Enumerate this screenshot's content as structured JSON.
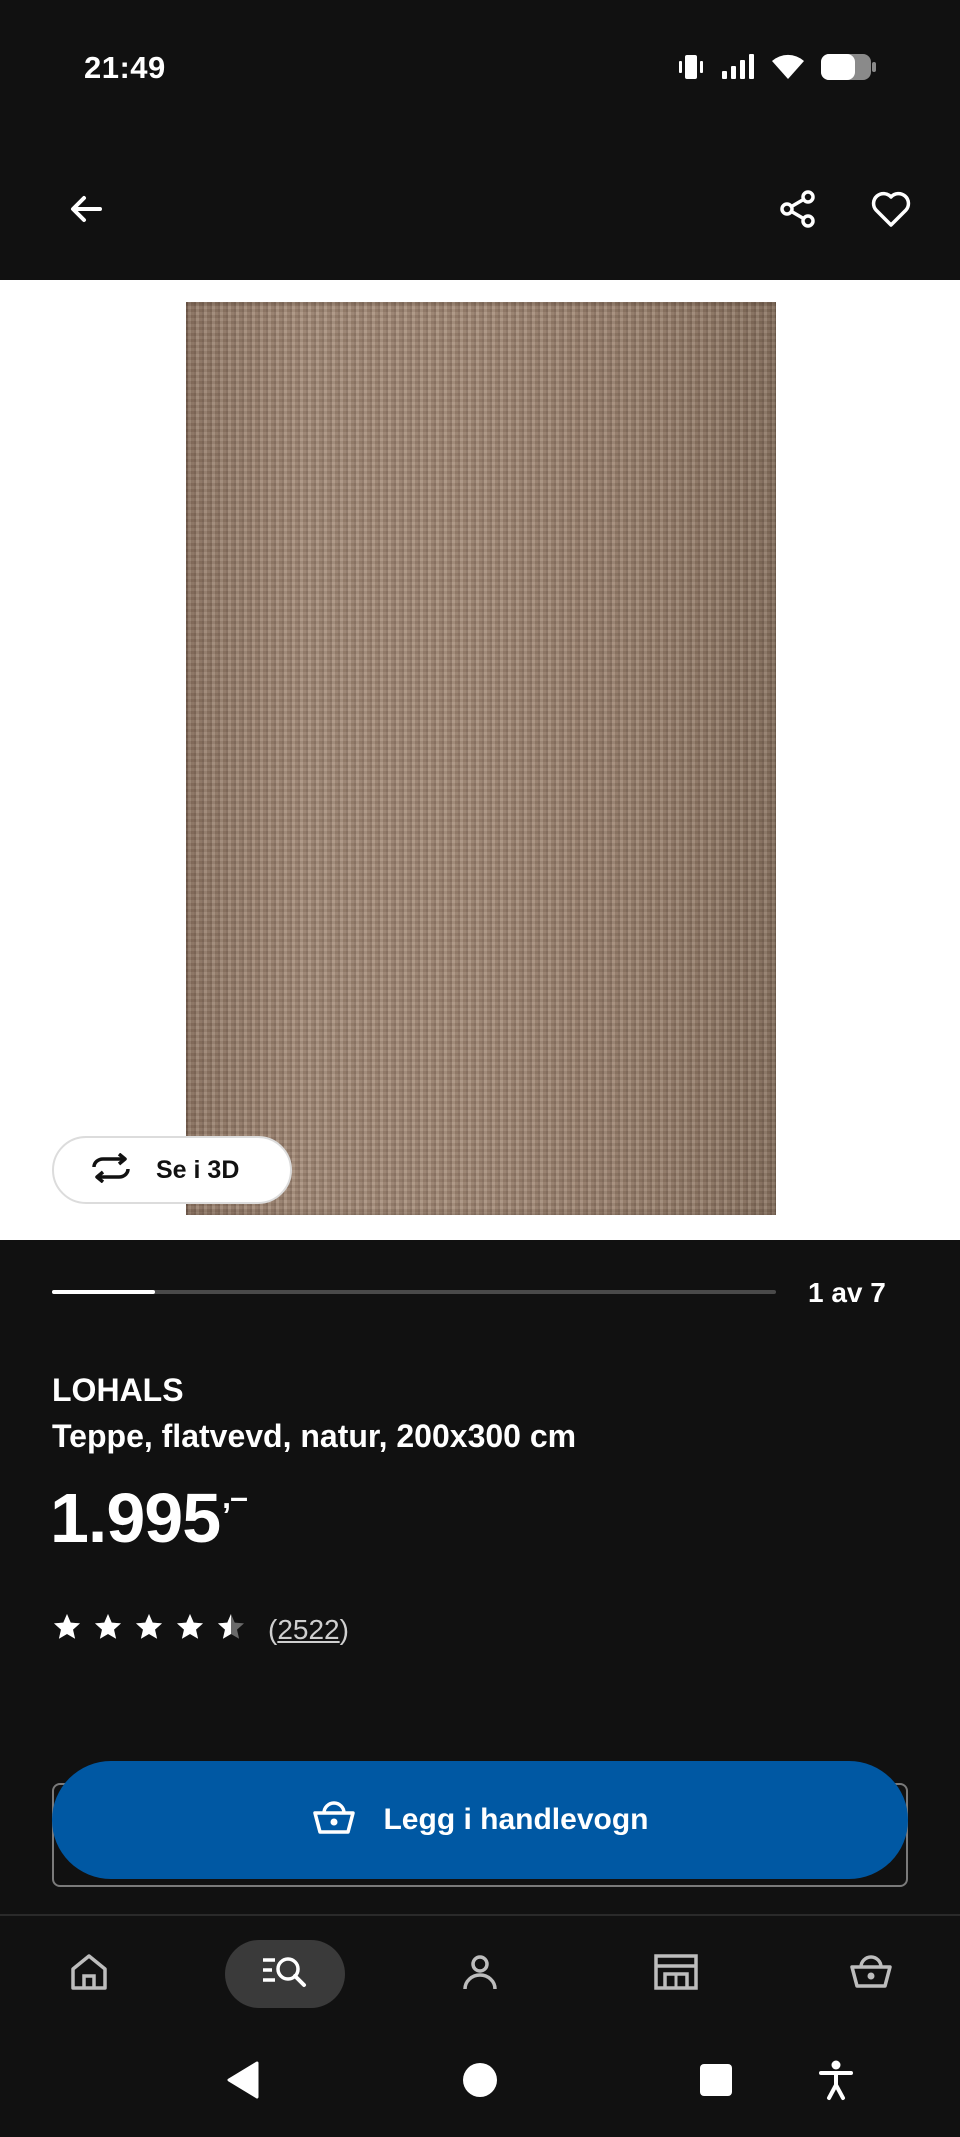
{
  "status_bar": {
    "time": "21:49",
    "icons": [
      "vibrate-icon",
      "signal-icon",
      "wifi-icon",
      "battery-icon"
    ]
  },
  "app_bar": {
    "icons": [
      "back-arrow-icon",
      "share-icon",
      "heart-icon"
    ]
  },
  "gallery": {
    "view_3d_label": "Se i 3D",
    "position_text": "1 av 7",
    "current_index": 1,
    "total": 7
  },
  "product": {
    "brand": "LOHALS",
    "description": "Teppe, flatvevd, natur, 200x300 cm",
    "price": "1.995",
    "price_suffix": ",–",
    "rating": 4.5,
    "rating_max": 5,
    "review_count": "2522"
  },
  "cart_button": {
    "label": "Legg i handlevogn",
    "icon": "basket-icon",
    "color": "#0058a3"
  },
  "bottom_nav": {
    "items": [
      "home-icon",
      "search-list-icon",
      "profile-icon",
      "store-icon",
      "basket-icon"
    ],
    "active": "search-list-icon"
  },
  "system_nav": {
    "items": [
      "back-triangle-icon",
      "home-circle-icon",
      "recents-square-icon",
      "accessibility-icon"
    ]
  }
}
